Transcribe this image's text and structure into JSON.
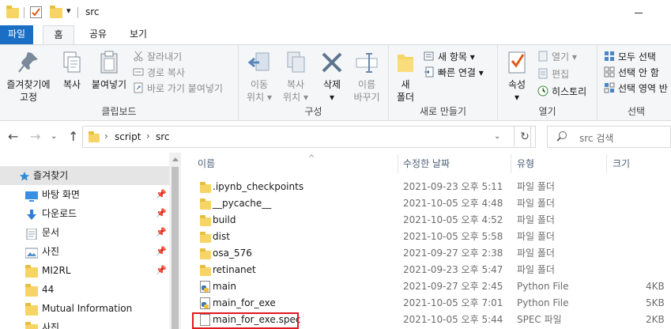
{
  "window": {
    "title": "src",
    "qat_dropdown": "▾"
  },
  "tabs": [
    {
      "label": "파일"
    },
    {
      "label": "홈"
    },
    {
      "label": "공유"
    },
    {
      "label": "보기"
    }
  ],
  "ribbon": {
    "clipboard": {
      "pin_label_1": "즐겨찾기에",
      "pin_label_2": "고정",
      "copy_label": "복사",
      "paste_label": "붙여넣기",
      "cut_label": "잘라내기",
      "copy_path_label": "경로 복사",
      "paste_shortcut_label": "바로 가기 붙여넣기",
      "group_label": "클립보드"
    },
    "organize": {
      "move_label_1": "이동",
      "move_label_2": "위치",
      "copyto_label_1": "복사",
      "copyto_label_2": "위치",
      "delete_label": "삭제",
      "rename_label_1": "이름",
      "rename_label_2": "바꾸기",
      "group_label": "구성"
    },
    "new": {
      "new_folder_label_1": "새",
      "new_folder_label_2": "폴더",
      "new_item_label": "새 항목",
      "easy_access_label": "빠른 연결",
      "group_label": "새로 만들기"
    },
    "open": {
      "properties_label": "속성",
      "open_label": "열기",
      "edit_label": "편집",
      "history_label": "히스토리",
      "group_label": "열기"
    },
    "select": {
      "select_all_label": "모두 선택",
      "select_none_label": "선택 안 함",
      "invert_label": "선택 영역 반",
      "group_label": "선택"
    }
  },
  "address": {
    "crumbs": [
      "script",
      "src"
    ],
    "search_placeholder": "src 검색"
  },
  "nav_pane": {
    "items": [
      {
        "label": "즐겨찾기",
        "icon": "star-icon",
        "pinned": false
      },
      {
        "label": "바탕 화면",
        "icon": "desktop-icon",
        "pinned": true
      },
      {
        "label": "다운로드",
        "icon": "download-icon",
        "pinned": true
      },
      {
        "label": "문서",
        "icon": "document-icon",
        "pinned": true
      },
      {
        "label": "사진",
        "icon": "picture-icon",
        "pinned": true
      },
      {
        "label": "MI2RL",
        "icon": "folder-icon",
        "pinned": true
      },
      {
        "label": "44",
        "icon": "folder-icon",
        "pinned": false
      },
      {
        "label": "Mutual Information",
        "icon": "folder-icon",
        "pinned": false
      },
      {
        "label": "사진",
        "icon": "folder-icon",
        "pinned": false
      }
    ]
  },
  "file_list": {
    "headers": {
      "name": "이름",
      "date": "수정한 날짜",
      "type": "유형",
      "size": "크기"
    },
    "rows": [
      {
        "name": ".ipynb_checkpoints",
        "date": "2021-09-23 오후 5:11",
        "type": "파일 폴더",
        "size": "",
        "icon": "folder-icon"
      },
      {
        "name": "__pycache__",
        "date": "2021-10-05 오후 4:48",
        "type": "파일 폴더",
        "size": "",
        "icon": "folder-icon"
      },
      {
        "name": "build",
        "date": "2021-10-05 오후 4:52",
        "type": "파일 폴더",
        "size": "",
        "icon": "folder-icon"
      },
      {
        "name": "dist",
        "date": "2021-10-05 오후 5:58",
        "type": "파일 폴더",
        "size": "",
        "icon": "folder-icon"
      },
      {
        "name": "osa_576",
        "date": "2021-09-27 오후 2:38",
        "type": "파일 폴더",
        "size": "",
        "icon": "folder-icon"
      },
      {
        "name": "retinanet",
        "date": "2021-09-23 오후 5:47",
        "type": "파일 폴더",
        "size": "",
        "icon": "folder-icon"
      },
      {
        "name": "main",
        "date": "2021-09-27 오후 2:45",
        "type": "Python File",
        "size": "4KB",
        "icon": "python-file-icon"
      },
      {
        "name": "main_for_exe",
        "date": "2021-10-05 오후 7:01",
        "type": "Python File",
        "size": "5KB",
        "icon": "python-file-icon"
      },
      {
        "name": "main_for_exe.spec",
        "date": "2021-10-05 오후 5:44",
        "type": "SPEC 파일",
        "size": "2KB",
        "icon": "file-icon"
      }
    ]
  },
  "colors": {
    "file_tab": "#1a6fc4",
    "highlight_box": "#e0191f",
    "folder": "#f6d465"
  }
}
